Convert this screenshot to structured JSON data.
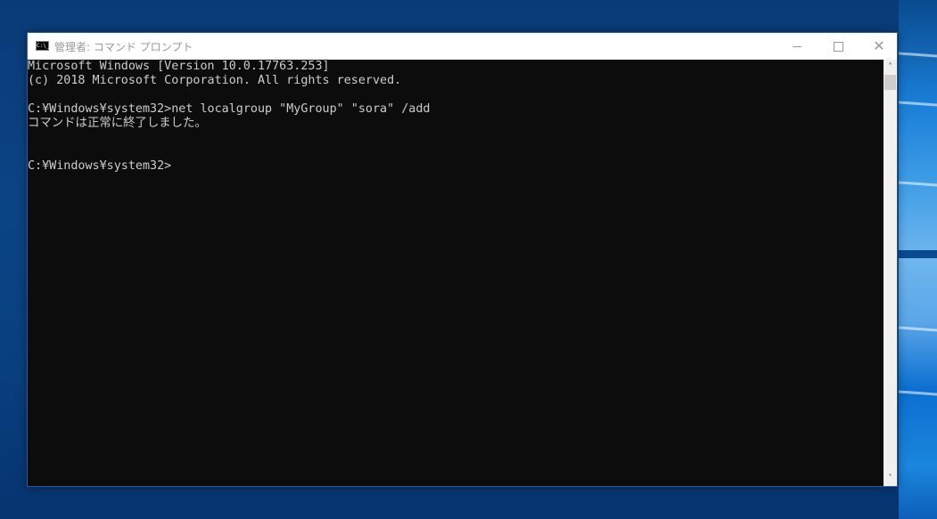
{
  "window": {
    "title": "管理者: コマンド プロンプト",
    "icon_label": "C:\\_",
    "controls": {
      "minimize": "minimize-icon",
      "maximize": "maximize-icon",
      "close": "close-icon"
    }
  },
  "console": {
    "lines": [
      "Microsoft Windows [Version 10.0.17763.253]",
      "(c) 2018 Microsoft Corporation. All rights reserved.",
      "",
      "C:¥Windows¥system32>net localgroup \"MyGroup\" \"sora\" /add",
      "コマンドは正常に終了しました。",
      "",
      "",
      "C:¥Windows¥system32>"
    ]
  },
  "scrollbar": {
    "up_glyph": "˄",
    "down_glyph": "˅"
  }
}
